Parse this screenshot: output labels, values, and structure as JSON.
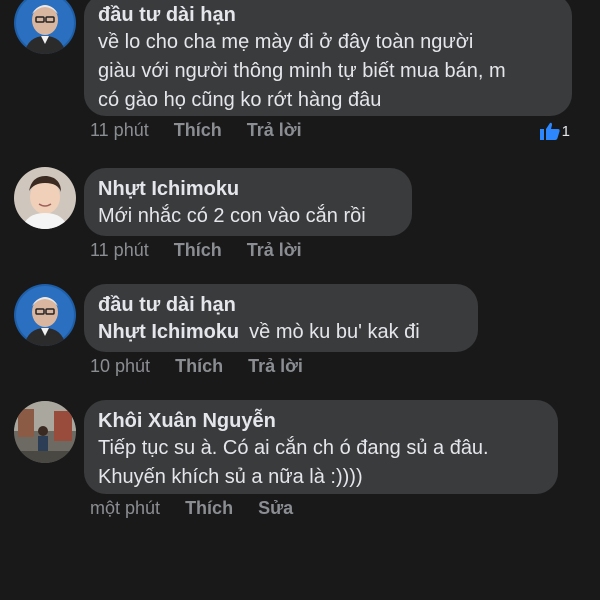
{
  "comments": [
    {
      "author": "đầu tư dài hạn",
      "lines": [
        "về lo cho cha mẹ mày đi ở đây toàn người",
        "giàu với người thông minh tự biết mua bán, m",
        "có gào họ cũng ko rớt hàng đâu"
      ],
      "time": "11 phút",
      "like_label": "Thích",
      "reply_label": "Trả lời",
      "reaction_count": "1"
    },
    {
      "author": "Nhựt Ichimoku",
      "lines": [
        "Mới nhắc có 2 con vào cắn rồi"
      ],
      "time": "11 phút",
      "like_label": "Thích",
      "reply_label": "Trả lời"
    },
    {
      "author": "đầu tư dài hạn",
      "mention": "Nhựt Ichimoku",
      "lines": [
        "về mò ku bu' kak đi"
      ],
      "time": "10 phút",
      "like_label": "Thích",
      "reply_label": "Trả lời"
    },
    {
      "author": "Khôi Xuân Nguyễn",
      "lines": [
        "Tiếp tục su à. Có ai cắn ch ó đang sủ a đâu.",
        "Khuyến khích sủ a nữa là :))))"
      ],
      "time": "một phút",
      "like_label": "Thích",
      "edit_label": "Sửa"
    }
  ],
  "colors": {
    "background": "#19191a",
    "bubble": "#3a3b3c",
    "meta_text": "#8a8d91",
    "like_blue": "#2d88ff"
  }
}
